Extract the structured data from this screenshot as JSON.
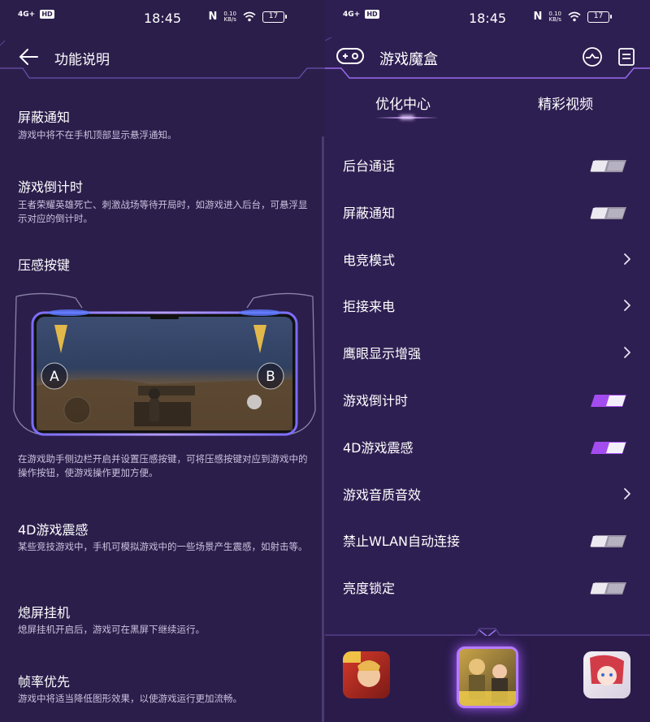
{
  "status_bar": {
    "signal": "4G+",
    "hd": "HD",
    "time": "18:45",
    "net_speed_value": "0.10",
    "net_speed_unit": "KB/s",
    "battery": "17"
  },
  "left_panel": {
    "header_title": "功能说明",
    "features": [
      {
        "title": "屏蔽通知",
        "desc": "游戏中将不在手机顶部显示悬浮通知。"
      },
      {
        "title": "游戏倒计时",
        "desc": "王者荣耀英雄死亡、刺激战场等待开局时，如游戏进入后台，可悬浮显示对应的倒计时。"
      },
      {
        "title": "压感按键",
        "desc": ""
      },
      {
        "title": "",
        "desc": "在游戏助手侧边栏开启并设置压感按键，可将压感按键对应到游戏中的操作按钮，使游戏操作更加方便。"
      },
      {
        "title": "4D游戏震感",
        "desc": "某些竞技游戏中，手机可模拟游戏中的一些场景产生震感，如射击等。"
      },
      {
        "title": "熄屏挂机",
        "desc": "熄屏挂机开启后，游戏可在黑屏下继续运行。"
      },
      {
        "title": "帧率优先",
        "desc": "游戏中将适当降低图形效果，以使游戏运行更加流畅。"
      }
    ],
    "illustration": {
      "button_a": "A",
      "button_b": "B"
    }
  },
  "right_panel": {
    "header_title": "游戏魔盒",
    "tabs": [
      {
        "label": "优化中心",
        "active": true
      },
      {
        "label": "精彩视频",
        "active": false
      }
    ],
    "settings": [
      {
        "label": "后台通话",
        "control": "toggle",
        "on": false
      },
      {
        "label": "屏蔽通知",
        "control": "toggle",
        "on": false
      },
      {
        "label": "电竞模式",
        "control": "chevron"
      },
      {
        "label": "拒接来电",
        "control": "chevron"
      },
      {
        "label": "鹰眼显示增强",
        "control": "chevron"
      },
      {
        "label": "游戏倒计时",
        "control": "toggle",
        "on": true
      },
      {
        "label": "4D游戏震感",
        "control": "toggle",
        "on": true
      },
      {
        "label": "游戏音质音效",
        "control": "chevron"
      },
      {
        "label": "禁止WLAN自动连接",
        "control": "toggle",
        "on": false
      },
      {
        "label": "亮度锁定",
        "control": "toggle",
        "on": false
      }
    ],
    "games": [
      {
        "icon": "game-icon-hero"
      },
      {
        "icon": "game-icon-battle"
      },
      {
        "icon": "game-icon-anime"
      }
    ]
  },
  "colors": {
    "background": "#2b1e4b",
    "accent": "#b46bff",
    "toggle_on": "#a34cf0",
    "toggle_off": "#9a94a6",
    "text_secondary": "#c9c2dd"
  }
}
